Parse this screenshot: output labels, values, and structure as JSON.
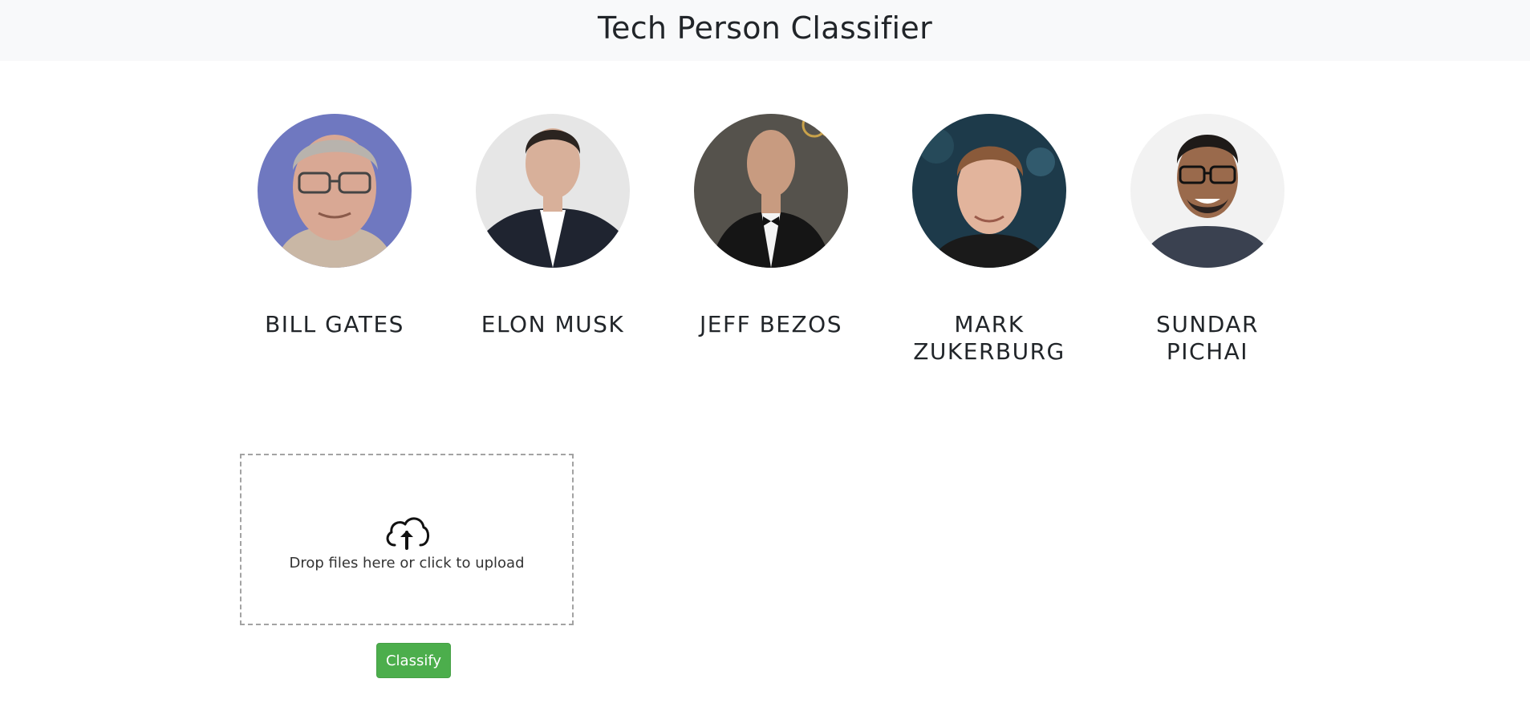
{
  "header": {
    "title": "Tech Person Classifier",
    "background": "#f8f9fa"
  },
  "people": [
    {
      "name": "BILL GATES",
      "photo": "bill-gates-photo",
      "bg_color": "#6f78c0"
    },
    {
      "name": "ELON MUSK",
      "photo": "elon-musk-photo",
      "bg_color": "#e6e6e6"
    },
    {
      "name": "JEFF BEZOS",
      "photo": "jeff-bezos-photo",
      "bg_color": "#55524c"
    },
    {
      "name": "MARK ZUKERBURG",
      "photo": "mark-zukerburg-photo",
      "bg_color": "#1d3a4a"
    },
    {
      "name": "SUNDAR PICHAI",
      "photo": "sundar-pichai-photo",
      "bg_color": "#f2f2f2"
    }
  ],
  "dropzone": {
    "icon": "cloud-upload-icon",
    "message": "Drop files here or click to upload"
  },
  "actions": {
    "classify_label": "Classify",
    "classify_color": "#4cae4c"
  }
}
